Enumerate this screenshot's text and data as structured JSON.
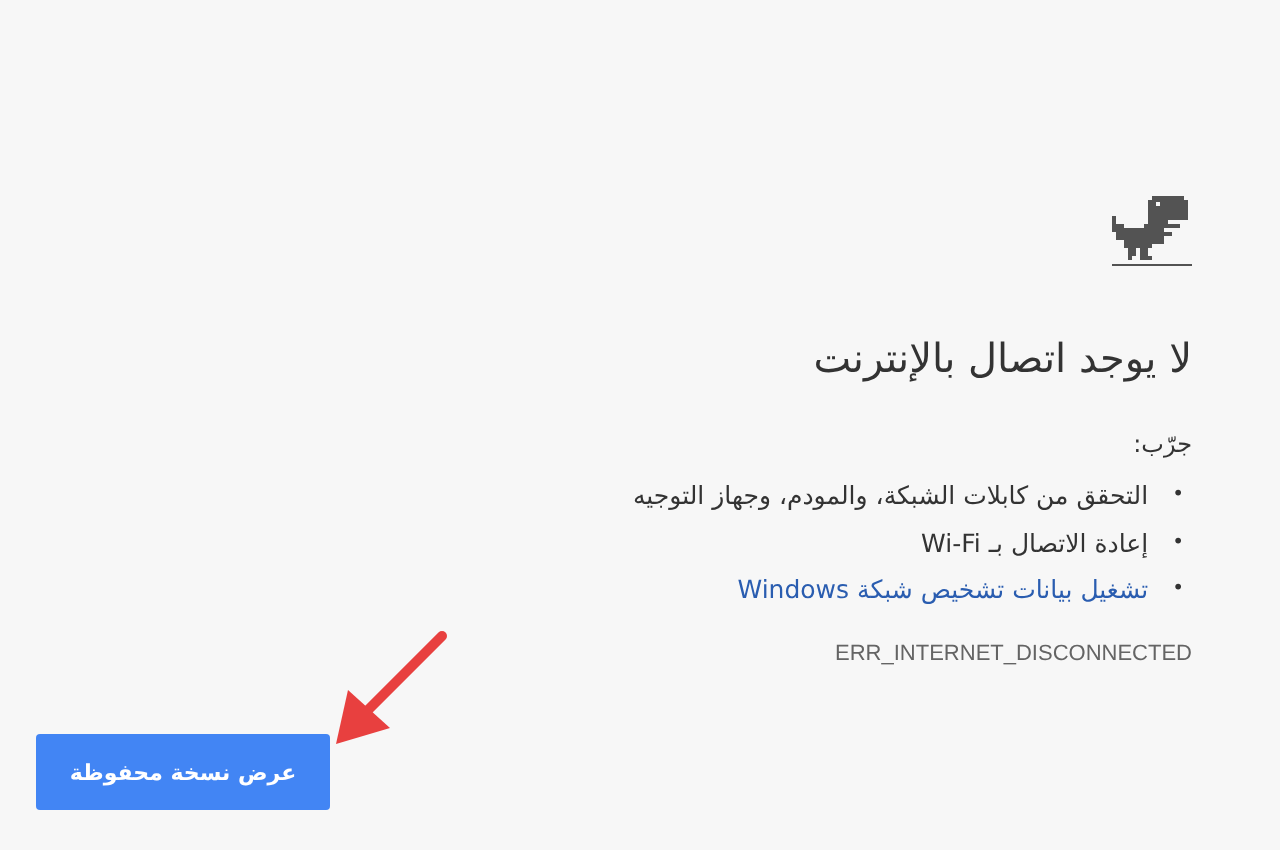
{
  "title": "لا يوجد اتصال بالإنترنت",
  "suggestions_heading": "جرّب:",
  "suggestions": [
    {
      "kind": "text",
      "bullet": "•",
      "text": "التحقق من كابلات الشبكة، والمودم، وجهاز التوجيه"
    },
    {
      "kind": "text",
      "bullet": "•",
      "text": "إعادة الاتصال بـ Wi-Fi"
    },
    {
      "kind": "link",
      "bullet": "•",
      "text": "تشغيل بيانات تشخيص شبكة Windows"
    }
  ],
  "error_code": "ERR_INTERNET_DISCONNECTED",
  "button": "عرض نسخة محفوظة"
}
